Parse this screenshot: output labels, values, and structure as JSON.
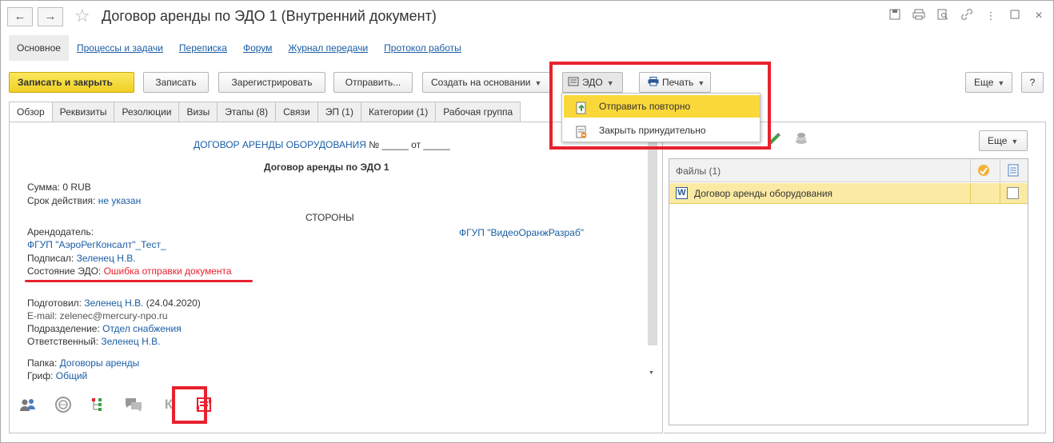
{
  "window": {
    "title": "Договор аренды по ЭДО 1 (Внутренний документ)",
    "back": "←",
    "forward": "→",
    "star": "☆",
    "title_icons": [
      "save-icon",
      "print-icon",
      "preview-icon",
      "link-icon",
      "more-icon",
      "maximize-icon",
      "close-icon"
    ],
    "close": "×",
    "more": "⋮"
  },
  "sections": [
    "Основное",
    "Процессы и задачи",
    "Переписка",
    "Форум",
    "Журнал передачи",
    "Протокол работы"
  ],
  "toolbar": {
    "write_close": "Записать и закрыть",
    "write": "Записать",
    "register": "Зарегистрировать",
    "send": "Отправить...",
    "create_based": "Создать на основании",
    "edo": "ЭДО",
    "print": "Печать",
    "more": "Еще",
    "help": "?"
  },
  "edo_menu": {
    "items": [
      "Отправить повторно",
      "Закрыть принудительно"
    ],
    "selected": "Отправить повторно"
  },
  "tabs": [
    "Обзор",
    "Реквизиты",
    "Резолюции",
    "Визы",
    "Этапы (8)",
    "Связи",
    "ЭП (1)",
    "Категории (1)",
    "Рабочая группа"
  ],
  "doc": {
    "header_blue": "ДОГОВОР АРЕНДЫ ОБОРУДОВАНИЯ",
    "header_rest": "№ _____ от _____",
    "subtitle": "Договор аренды по ЭДО 1",
    "sum_label": "Сумма:",
    "sum_value": "0 RUB",
    "term_label": "Срок действия:",
    "term_value": "не указан",
    "sides": "СТОРОНЫ",
    "lessor_label": "Арендодатель:",
    "lessor_org": "ФГУП \"АэроРегКонсалт\"_Тест_",
    "lessee_org": "ФГУП \"ВидеоОранжРазраб\"",
    "signed_label": "Подписал:",
    "signed_value": "Зеленец Н.В.",
    "edo_state_label": "Состояние ЭДО:",
    "edo_state_value": "Ошибка отправки документа",
    "prepared_label": "Подготовил:",
    "prepared_value": "Зеленец Н.В.",
    "prepared_date": "(24.04.2020)",
    "email": "E-mail: zelenec@mercury-npo.ru",
    "dept_label": "Подразделение:",
    "dept_value": "Отдел снабжения",
    "resp_label": "Ответственный:",
    "resp_value": "Зеленец Н.В.",
    "folder_label": "Папка:",
    "folder_value": "Договоры аренды",
    "grif_label": "Гриф:",
    "grif_value": "Общий"
  },
  "bottom_icons": [
    "users-icon",
    "stamp-icon",
    "tree-icon",
    "chat-icon",
    "k-icon",
    "edo-exchange-icon"
  ],
  "bottom_k": "К",
  "files": {
    "more": "Еще",
    "header": "Файлы (1)",
    "rows": [
      {
        "name": "Договор аренды оборудования",
        "type": "W"
      }
    ]
  },
  "colors": {
    "accent_red": "#e8212e",
    "link_blue": "#1a5da5",
    "selected_yellow": "#fbd83a"
  }
}
